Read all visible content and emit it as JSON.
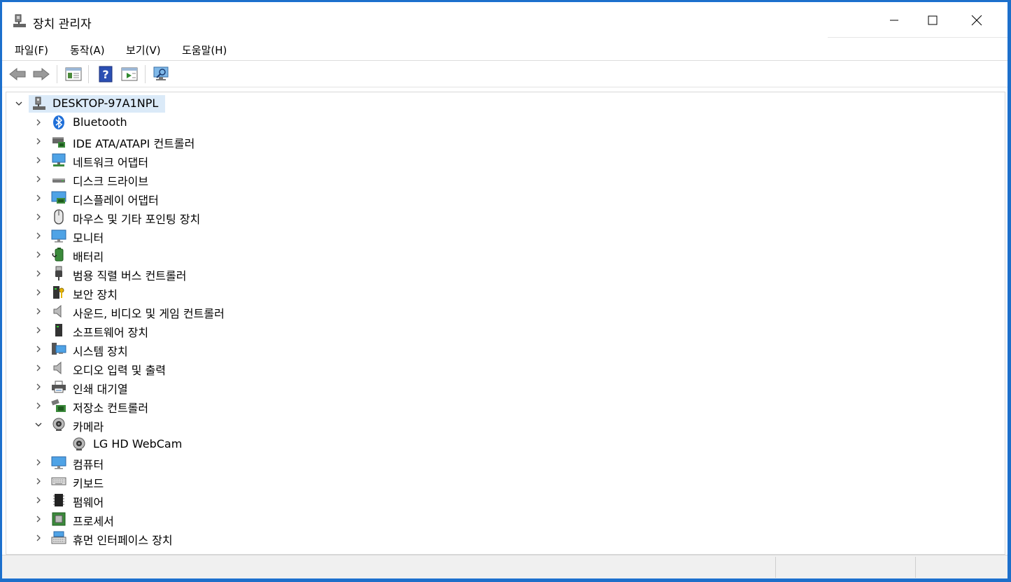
{
  "window": {
    "title": "장치 관리자",
    "controls": {
      "minimize": "minimize-icon",
      "maximize": "maximize-icon",
      "close": "close-icon"
    }
  },
  "menu": [
    {
      "label": "파일(F)"
    },
    {
      "label": "동작(A)"
    },
    {
      "label": "보기(V)"
    },
    {
      "label": "도움말(H)"
    }
  ],
  "toolbar": [
    "back-arrow-icon",
    "forward-arrow-icon",
    "properties-icon",
    "help-icon",
    "run-icon",
    "scan-hardware-icon"
  ],
  "tree": {
    "root": {
      "label": "DESKTOP-97A1NPL",
      "expanded": true,
      "icon": "computer-network-icon"
    },
    "categories": [
      {
        "label": "Bluetooth",
        "icon": "bluetooth-icon"
      },
      {
        "label": "IDE ATA/ATAPI 컨트롤러",
        "icon": "ide-controller-icon"
      },
      {
        "label": "네트워크 어댑터",
        "icon": "network-adapter-icon"
      },
      {
        "label": "디스크 드라이브",
        "icon": "disk-drive-icon"
      },
      {
        "label": "디스플레이 어댑터",
        "icon": "display-adapter-icon"
      },
      {
        "label": "마우스 및 기타 포인팅 장치",
        "icon": "mouse-icon"
      },
      {
        "label": "모니터",
        "icon": "monitor-icon"
      },
      {
        "label": "배터리",
        "icon": "battery-icon"
      },
      {
        "label": "범용 직렬 버스 컨트롤러",
        "icon": "usb-icon"
      },
      {
        "label": "보안 장치",
        "icon": "security-key-icon"
      },
      {
        "label": "사운드, 비디오 및 게임 컨트롤러",
        "icon": "speaker-icon"
      },
      {
        "label": "소프트웨어 장치",
        "icon": "software-device-icon"
      },
      {
        "label": "시스템 장치",
        "icon": "system-device-icon"
      },
      {
        "label": "오디오 입력 및 출력",
        "icon": "audio-io-icon"
      },
      {
        "label": "인쇄 대기열",
        "icon": "printer-icon"
      },
      {
        "label": "저장소 컨트롤러",
        "icon": "storage-controller-icon"
      },
      {
        "label": "카메라",
        "icon": "camera-icon",
        "expanded": true,
        "children": [
          {
            "label": "LG HD WebCam",
            "icon": "webcam-icon"
          }
        ]
      },
      {
        "label": "컴퓨터",
        "icon": "computer-icon"
      },
      {
        "label": "키보드",
        "icon": "keyboard-icon"
      },
      {
        "label": "펌웨어",
        "icon": "firmware-icon"
      },
      {
        "label": "프로세서",
        "icon": "processor-icon"
      },
      {
        "label": "휴먼 인터페이스 장치",
        "icon": "hid-icon"
      }
    ]
  },
  "colors": {
    "accent": "#1e6fc9",
    "selection": "#dbeaf8",
    "statusbar": "#f0f0f0"
  }
}
